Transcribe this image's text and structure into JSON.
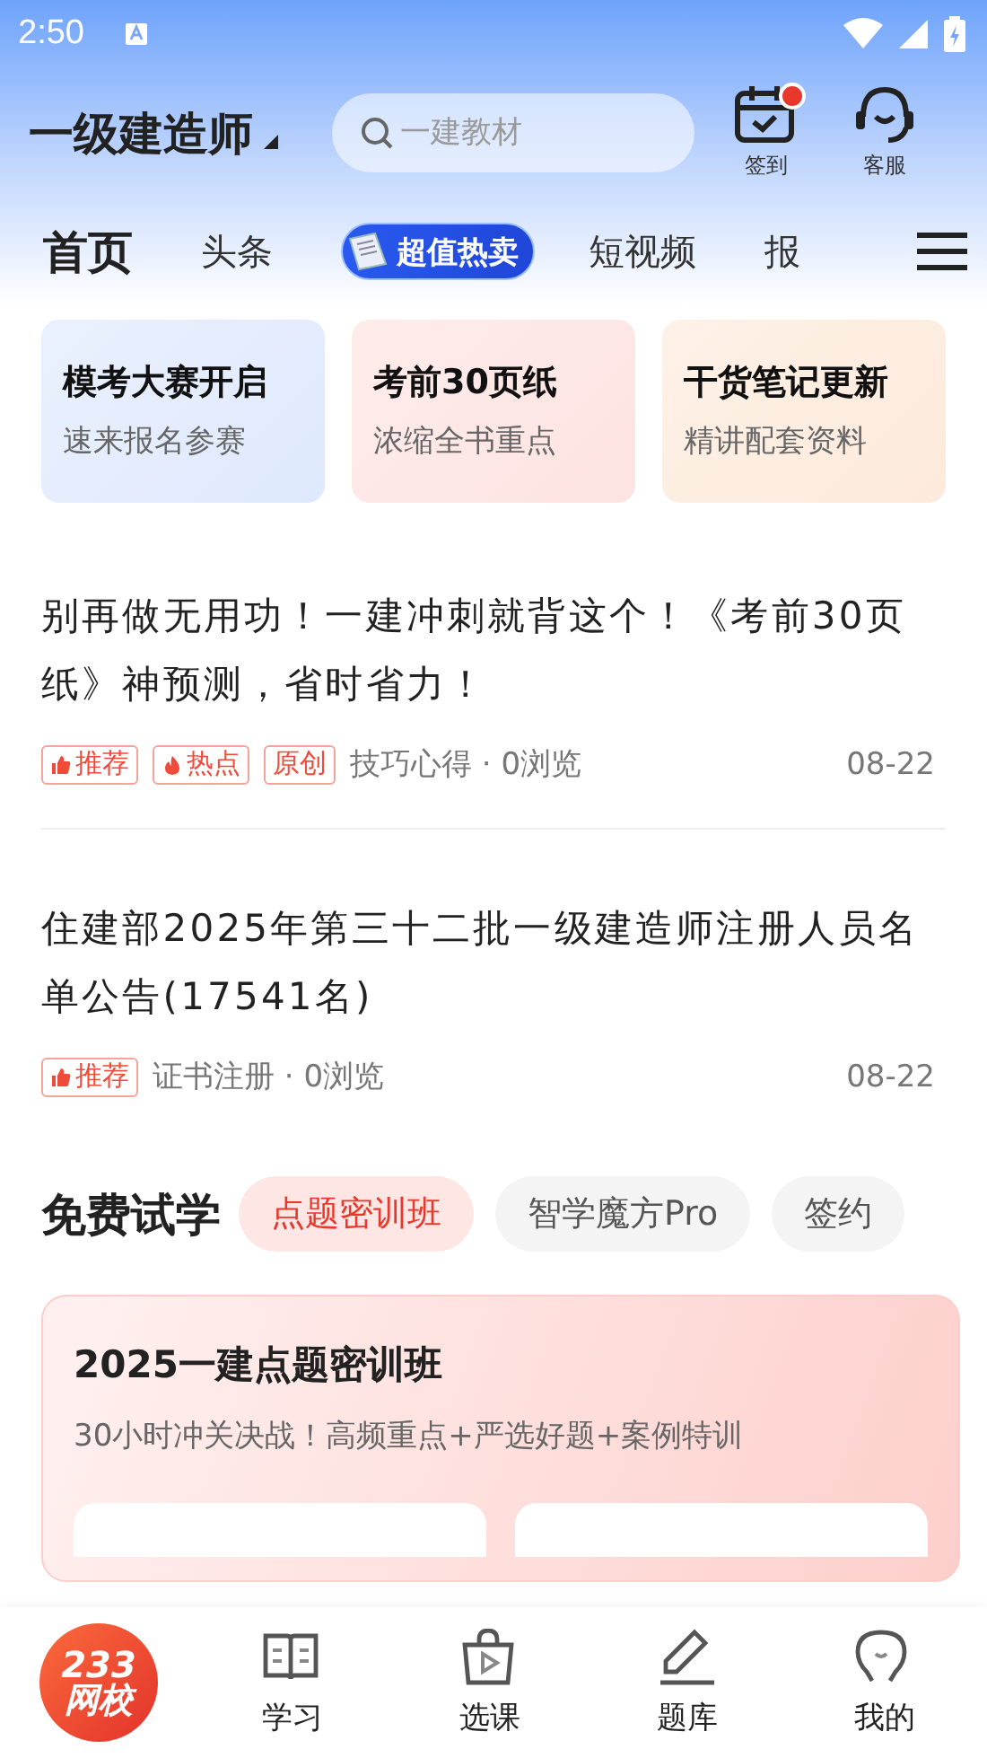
{
  "status_bar": {
    "time": "2:50"
  },
  "header": {
    "title": "一级建造师",
    "search": {
      "placeholder": "一建教材"
    },
    "actions": [
      {
        "kind": "calendar",
        "label": "签到",
        "badge": true
      },
      {
        "kind": "headset",
        "label": "客服",
        "badge": false
      }
    ]
  },
  "tabs": [
    {
      "label": "首页",
      "kind": "text",
      "selected": true
    },
    {
      "label": "头条",
      "kind": "text",
      "selected": false
    },
    {
      "label": "超值热卖",
      "kind": "promo",
      "selected": false
    },
    {
      "label": "短视频",
      "kind": "text",
      "selected": false
    },
    {
      "label": "报",
      "kind": "text",
      "selected": false
    }
  ],
  "promo_cards": [
    {
      "title": "模考大赛开启",
      "subtitle": "速来报名参赛",
      "color": "#dfe9fd"
    },
    {
      "title": "考前30页纸",
      "subtitle": "浓缩全书重点",
      "color": "#fde3e1"
    },
    {
      "title": "干货笔记更新",
      "subtitle": "精讲配套资料",
      "color": "#fdeadb"
    }
  ],
  "articles": [
    {
      "title": "别再做无用功！一建冲刺就背这个！《考前30页纸》神预测，省时省力！",
      "tags": [
        {
          "label": "推荐",
          "kind": "thumb"
        },
        {
          "label": "热点",
          "kind": "fire"
        },
        {
          "label": "原创",
          "kind": "plain"
        }
      ],
      "meta": "技巧心得 · 0浏览",
      "date": "08-22"
    },
    {
      "title": "住建部2025年第三十二批一级建造师注册人员名单公告(17541名)",
      "tags": [
        {
          "label": "推荐",
          "kind": "thumb"
        }
      ],
      "meta": "证书注册 · 0浏览",
      "date": "08-22"
    }
  ],
  "free_trial": {
    "title": "免费试学",
    "chips": [
      {
        "label": "点题密训班",
        "selected": true
      },
      {
        "label": "智学魔方Pro",
        "selected": false
      },
      {
        "label": "签约",
        "selected": false
      }
    ],
    "course": {
      "title": "2025一建点题密训班",
      "subtitle": "30小时冲关决战！高频重点+严选好题+案例特训"
    }
  },
  "bottom_nav": [
    {
      "kind": "logo",
      "label": "233",
      "label2": "网校",
      "selected": true
    },
    {
      "kind": "book",
      "label": "学习",
      "selected": false
    },
    {
      "kind": "bag",
      "label": "选课",
      "selected": false
    },
    {
      "kind": "pencil",
      "label": "题库",
      "selected": false
    },
    {
      "kind": "face",
      "label": "我的",
      "selected": false
    }
  ]
}
